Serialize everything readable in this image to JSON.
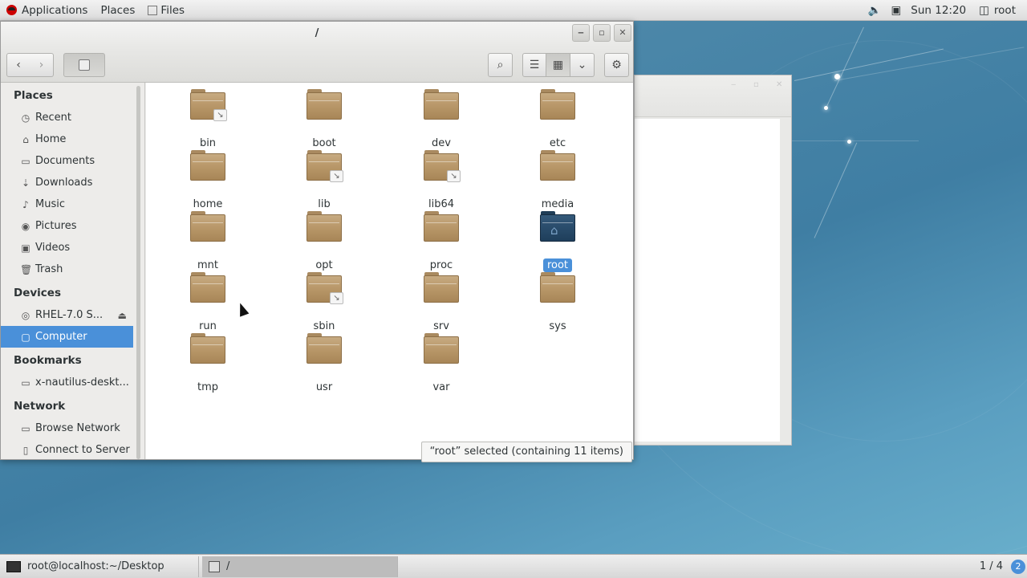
{
  "topbar": {
    "applications": "Applications",
    "places": "Places",
    "files": "Files",
    "clock": "Sun 12:20",
    "user": "root"
  },
  "window": {
    "title": "/",
    "minimize": "‒",
    "maximize": "▫",
    "close": "✕"
  },
  "toolbar": {
    "back": "‹",
    "forward": "›",
    "search": "⌕",
    "list_view": "☰",
    "grid_view": "▦",
    "view_menu": "⌄",
    "settings": "⚙"
  },
  "sidebar": {
    "places_header": "Places",
    "places": [
      {
        "label": "Recent",
        "icon": "◷"
      },
      {
        "label": "Home",
        "icon": "⌂"
      },
      {
        "label": "Documents",
        "icon": "▭"
      },
      {
        "label": "Downloads",
        "icon": "⇣"
      },
      {
        "label": "Music",
        "icon": "♪"
      },
      {
        "label": "Pictures",
        "icon": "◉"
      },
      {
        "label": "Videos",
        "icon": "▣"
      },
      {
        "label": "Trash",
        "icon": "🗑"
      }
    ],
    "devices_header": "Devices",
    "devices": [
      {
        "label": "RHEL-7.0 S...",
        "icon": "◎"
      },
      {
        "label": "Computer",
        "icon": "▢"
      }
    ],
    "bookmarks_header": "Bookmarks",
    "bookmarks": [
      {
        "label": "x-nautilus-deskt...",
        "icon": "▭"
      }
    ],
    "network_header": "Network",
    "network": [
      {
        "label": "Browse Network",
        "icon": "▭"
      },
      {
        "label": "Connect to Server",
        "icon": "▯"
      }
    ]
  },
  "folders": [
    {
      "name": "bin",
      "link": true
    },
    {
      "name": "boot",
      "link": false
    },
    {
      "name": "dev",
      "link": false
    },
    {
      "name": "etc",
      "link": false
    },
    {
      "name": "home",
      "link": false
    },
    {
      "name": "lib",
      "link": true
    },
    {
      "name": "lib64",
      "link": true
    },
    {
      "name": "media",
      "link": false
    },
    {
      "name": "mnt",
      "link": false
    },
    {
      "name": "opt",
      "link": false
    },
    {
      "name": "proc",
      "link": false
    },
    {
      "name": "root",
      "link": false,
      "selected": true
    },
    {
      "name": "run",
      "link": false
    },
    {
      "name": "sbin",
      "link": true
    },
    {
      "name": "srv",
      "link": false
    },
    {
      "name": "sys",
      "link": false
    },
    {
      "name": "tmp",
      "link": false
    },
    {
      "name": "usr",
      "link": false
    },
    {
      "name": "var",
      "link": false
    }
  ],
  "status": "“root” selected (containing 11 items)",
  "taskbar": {
    "terminal": "root@localhost:~/Desktop",
    "files": "/",
    "workspace": "1 / 4",
    "notifications": "2"
  }
}
